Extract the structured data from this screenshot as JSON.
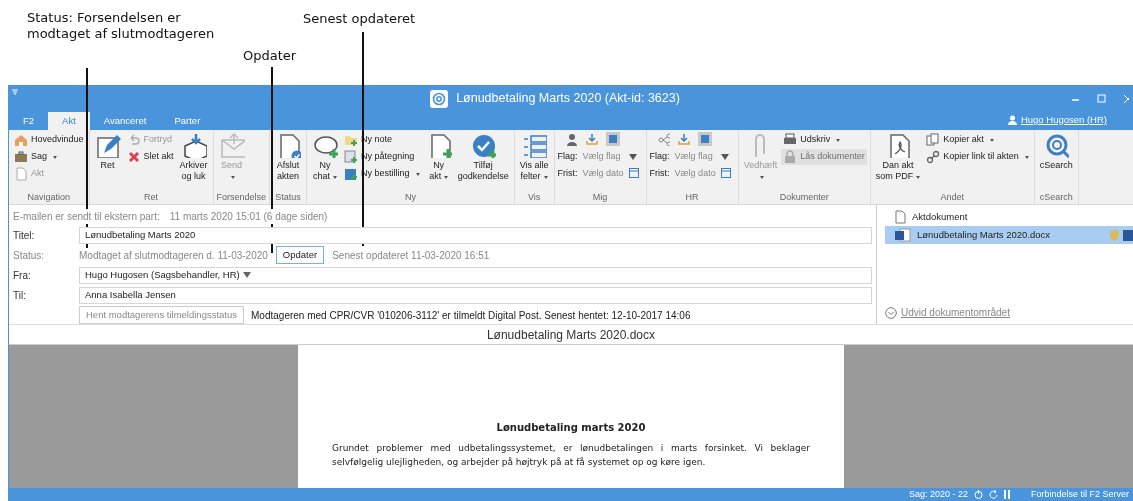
{
  "annotations": [
    {
      "text": "Status: Forsendelsen er modtaget af slutmodtageren"
    },
    {
      "text": "Opdater"
    },
    {
      "text": "Senest opdateret"
    }
  ],
  "window": {
    "title": "Lønudbetaling Marts 2020 (Akt-id: 3623)",
    "user": "Hugo Hugosen (HR)"
  },
  "tabs": [
    {
      "label": "F2",
      "selected": false
    },
    {
      "label": "Akt",
      "selected": true
    },
    {
      "label": "Avanceret",
      "selected": false
    },
    {
      "label": "Parter",
      "selected": false
    }
  ],
  "ribbon_groups": [
    {
      "label": "Navigation",
      "items": [
        {
          "kind": "stack",
          "items": [
            {
              "kind": "small",
              "label": "Hovedvindue",
              "disabled": false,
              "dropdown": false
            },
            {
              "kind": "small",
              "label": "Sag",
              "disabled": false,
              "dropdown": true
            },
            {
              "kind": "small",
              "label": "Akt",
              "disabled": true,
              "dropdown": false
            }
          ]
        }
      ]
    },
    {
      "label": "Ret",
      "items": [
        {
          "kind": "large",
          "label": "Ret",
          "disabled": false,
          "dropdown": false
        },
        {
          "kind": "stack",
          "items": [
            {
              "kind": "small",
              "label": "Fortryd",
              "disabled": true,
              "dropdown": false
            },
            {
              "kind": "small",
              "label": "Slet akt",
              "disabled": false,
              "dropdown": false
            }
          ]
        },
        {
          "kind": "large",
          "label": "Arkiver\nog luk",
          "disabled": false,
          "dropdown": false
        }
      ]
    },
    {
      "label": "Forsendelse",
      "items": [
        {
          "kind": "large",
          "label": "Send",
          "disabled": true,
          "dropdown": true
        }
      ]
    },
    {
      "label": "Status",
      "items": [
        {
          "kind": "large",
          "label": "Afslut\nakten",
          "disabled": false,
          "dropdown": false
        }
      ]
    },
    {
      "label": "Ny",
      "items": [
        {
          "kind": "large",
          "label": "Ny\nchat",
          "disabled": false,
          "dropdown": true
        },
        {
          "kind": "stack",
          "items": [
            {
              "kind": "small",
              "label": "Ny note",
              "disabled": false,
              "dropdown": false
            },
            {
              "kind": "small",
              "label": "Ny påtegning",
              "disabled": false,
              "dropdown": false
            },
            {
              "kind": "small",
              "label": "Ny bestilling",
              "disabled": false,
              "dropdown": true
            }
          ]
        },
        {
          "kind": "large",
          "label": "Ny\nakt",
          "disabled": false,
          "dropdown": true
        },
        {
          "kind": "large",
          "label": "Tilføj\ngodkendelse",
          "disabled": false,
          "dropdown": false
        }
      ]
    },
    {
      "label": "Vis",
      "items": [
        {
          "kind": "large",
          "label": "Vis alle\nfelter",
          "disabled": false,
          "dropdown": true
        }
      ]
    },
    {
      "label": "Mig",
      "items": [
        {
          "kind": "flags",
          "fields": [
            {
              "label": "Flag:",
              "placeholder": "Vælg flag"
            },
            {
              "label": "Frist:",
              "placeholder": "Vælg dato"
            }
          ]
        }
      ]
    },
    {
      "label": "HR",
      "items": [
        {
          "kind": "flags",
          "fields": [
            {
              "label": "Flag:",
              "placeholder": "Vælg flag"
            },
            {
              "label": "Frist:",
              "placeholder": "Vælg dato"
            }
          ]
        }
      ]
    },
    {
      "label": "Dokumenter",
      "items": [
        {
          "kind": "large",
          "label": "Vedhæft",
          "disabled": true,
          "dropdown": true
        },
        {
          "kind": "stack",
          "items": [
            {
              "kind": "small",
              "label": "Udskriv",
              "disabled": false,
              "dropdown": true
            },
            {
              "kind": "small",
              "label": "Lås dokumenter",
              "disabled": true,
              "dropdown": false
            }
          ]
        }
      ]
    },
    {
      "label": "Andet",
      "items": [
        {
          "kind": "large",
          "label": "Dan akt\nsom PDF",
          "disabled": false,
          "dropdown": true
        },
        {
          "kind": "stack",
          "items": [
            {
              "kind": "small",
              "label": "Kopier akt",
              "disabled": false,
              "dropdown": true
            },
            {
              "kind": "small",
              "label": "Kopier link til akten",
              "disabled": false,
              "dropdown": true
            }
          ]
        }
      ]
    },
    {
      "label": "cSearch",
      "items": [
        {
          "kind": "large",
          "label": "cSearch",
          "disabled": false,
          "dropdown": false
        }
      ]
    }
  ],
  "sent_info": {
    "label": "E-mailen er sendt til ekstern part:",
    "value": "11 marts 2020 15:01 (6 dage siden)"
  },
  "fields": [
    {
      "kind": "input",
      "label": "Titel:",
      "value": "Lønudbetaling Marts 2020"
    },
    {
      "kind": "status",
      "label": "Status:",
      "value": "Modtaget af slutmodtageren d. 11-03-2020",
      "button": "Opdater",
      "note": "Senest opdateret 11-03-2020 16:51"
    },
    {
      "kind": "select",
      "label": "Fra:",
      "value": "Hugo Hugosen (Sagsbehandler, HR)"
    },
    {
      "kind": "input",
      "label": "Til:",
      "value": "Anna Isabella Jensen"
    },
    {
      "kind": "action",
      "button": "Hent modtagerens tilmeldingsstatus",
      "note": "Modtageren med CPR/CVR '010206-3112' er tilmeldt Digital Post. Senest hentet: 12-10-2017 14:06"
    }
  ],
  "documents": [
    {
      "name": "Aktdokument",
      "selected": false
    },
    {
      "name": "Lønudbetaling Marts 2020.docx",
      "selected": true
    }
  ],
  "expand_link": "Udvid dokumentområdet",
  "viewer": {
    "title": "Lønudbetaling Marts 2020.docx",
    "heading": "Lønudbetaling marts 2020",
    "body": "Grundet problemer med udbetalingssystemet, er lønudbetalingen i marts forsinket. Vi beklager selvfølgelig ulejligheden, og arbejder på højtryk på at få systemet op og køre igen."
  },
  "status_bar": {
    "case": "Sag: 2020 - 22",
    "connection": "Forbindelse til F2 Server"
  }
}
